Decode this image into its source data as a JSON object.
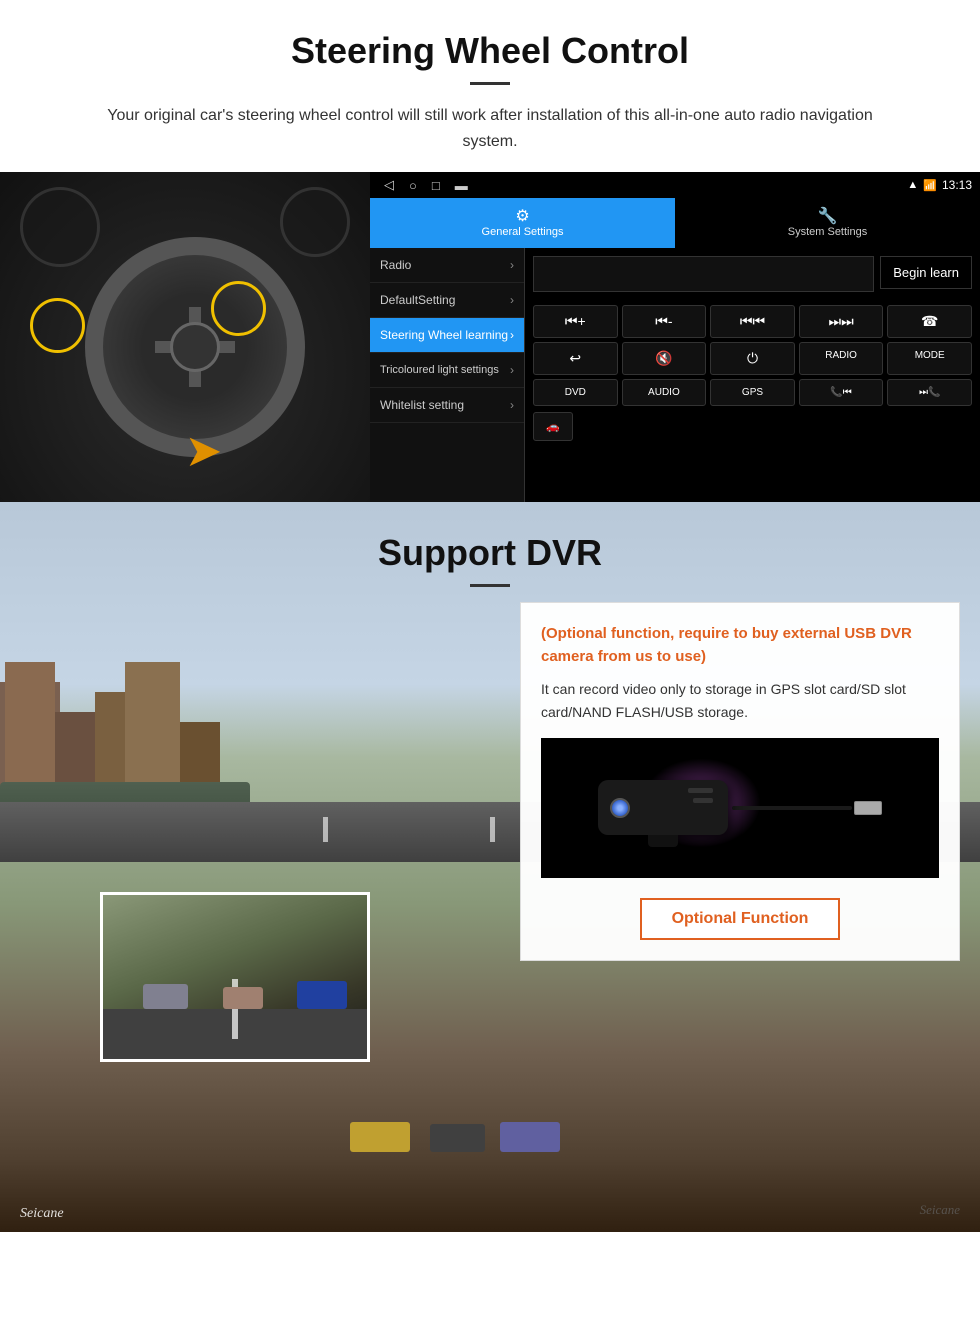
{
  "section1": {
    "title": "Steering Wheel Control",
    "subtitle": "Your original car's steering wheel control will still work after installation of this all-in-one auto radio navigation system.",
    "android": {
      "statusbar": {
        "time": "13:13",
        "icons": [
          "signal",
          "wifi",
          "battery"
        ]
      },
      "tabs": [
        {
          "label": "General Settings",
          "active": true
        },
        {
          "label": "System Settings",
          "active": false
        }
      ],
      "menu_items": [
        {
          "label": "Radio",
          "active": false
        },
        {
          "label": "DefaultSetting",
          "active": false
        },
        {
          "label": "Steering Wheel learning",
          "active": true
        },
        {
          "label": "Tricoloured light settings",
          "active": false
        },
        {
          "label": "Whitelist setting",
          "active": false
        }
      ],
      "begin_learn": "Begin learn",
      "control_buttons": [
        "⏮+",
        "⏮-",
        "⏮⏮",
        "⏭⏭",
        "☎",
        "↩",
        "🔇",
        "⏻",
        "RADIO",
        "MODE",
        "DVD",
        "AUDIO",
        "GPS",
        "📞⏮",
        "⏭📞"
      ]
    }
  },
  "section2": {
    "title": "Support DVR",
    "optional_text": "(Optional function, require to buy external USB DVR camera from us to use)",
    "desc_text": "It can record video only to storage in GPS slot card/SD slot card/NAND FLASH/USB storage.",
    "optional_function_btn": "Optional Function",
    "watermark1": "Seicane",
    "watermark2": "Seicane"
  }
}
